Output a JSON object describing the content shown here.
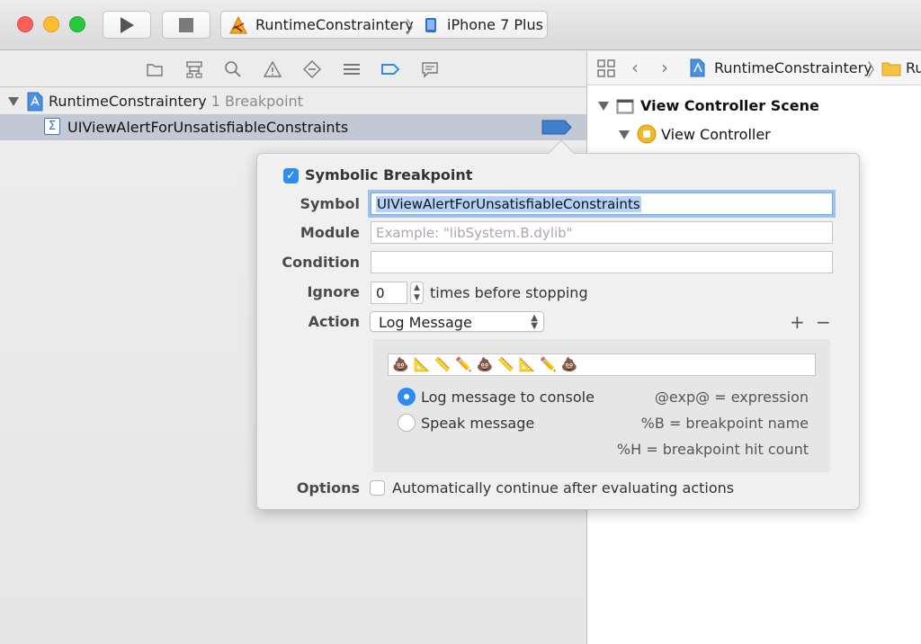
{
  "toolbar": {
    "project_name": "RuntimeConstraintery",
    "separator": "〉",
    "device": "iPhone 7 Plus"
  },
  "navigator": {
    "root_label": "RuntimeConstraintery",
    "root_count": "1 Breakpoint",
    "breakpoint_label": "UIViewAlertForUnsatisfiableConstraints"
  },
  "editor": {
    "project_name": "RuntimeConstraintery",
    "separator": "〉",
    "truncated_label": "Ru",
    "scene_label": "View Controller Scene",
    "vc_label": "View Controller"
  },
  "popover": {
    "title": "Symbolic Breakpoint",
    "symbol_label": "Symbol",
    "symbol_value": "UIViewAlertForUnsatisfiableConstraints",
    "module_label": "Module",
    "module_placeholder": "Example: \"libSystem.B.dylib\"",
    "condition_label": "Condition",
    "condition_value": "",
    "ignore_label": "Ignore",
    "ignore_value": "0",
    "ignore_suffix": "times before stopping",
    "action_label": "Action",
    "action_value": "Log Message",
    "plus": "+",
    "minus": "−",
    "log_message_text": "💩 📐 📏 ✏️ 💩 📏 📐 ✏️ 💩",
    "radio_console": "Log message to console",
    "radio_speak": "Speak message",
    "hint_expression": "@exp@ = expression",
    "hint_name": "%B = breakpoint name",
    "hint_hitcount": "%H = breakpoint hit count",
    "options_label": "Options",
    "options_text": "Automatically continue after evaluating actions"
  }
}
